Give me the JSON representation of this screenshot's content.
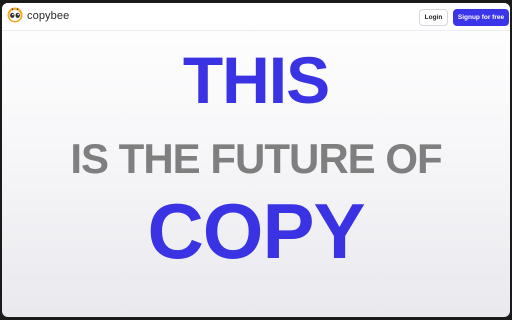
{
  "header": {
    "brand": "copybee",
    "login_label": "Login",
    "signup_label": "Signup for free"
  },
  "hero": {
    "line_1": "THIS",
    "line_2": "IS THE FUTURE OF",
    "line_3": "COPY"
  },
  "icons": {
    "logo": "bee-logo-icon"
  },
  "colors": {
    "accent": "#3a33e3",
    "secondary_text": "#7f7f7f",
    "signup_button": "#3b35ea"
  }
}
